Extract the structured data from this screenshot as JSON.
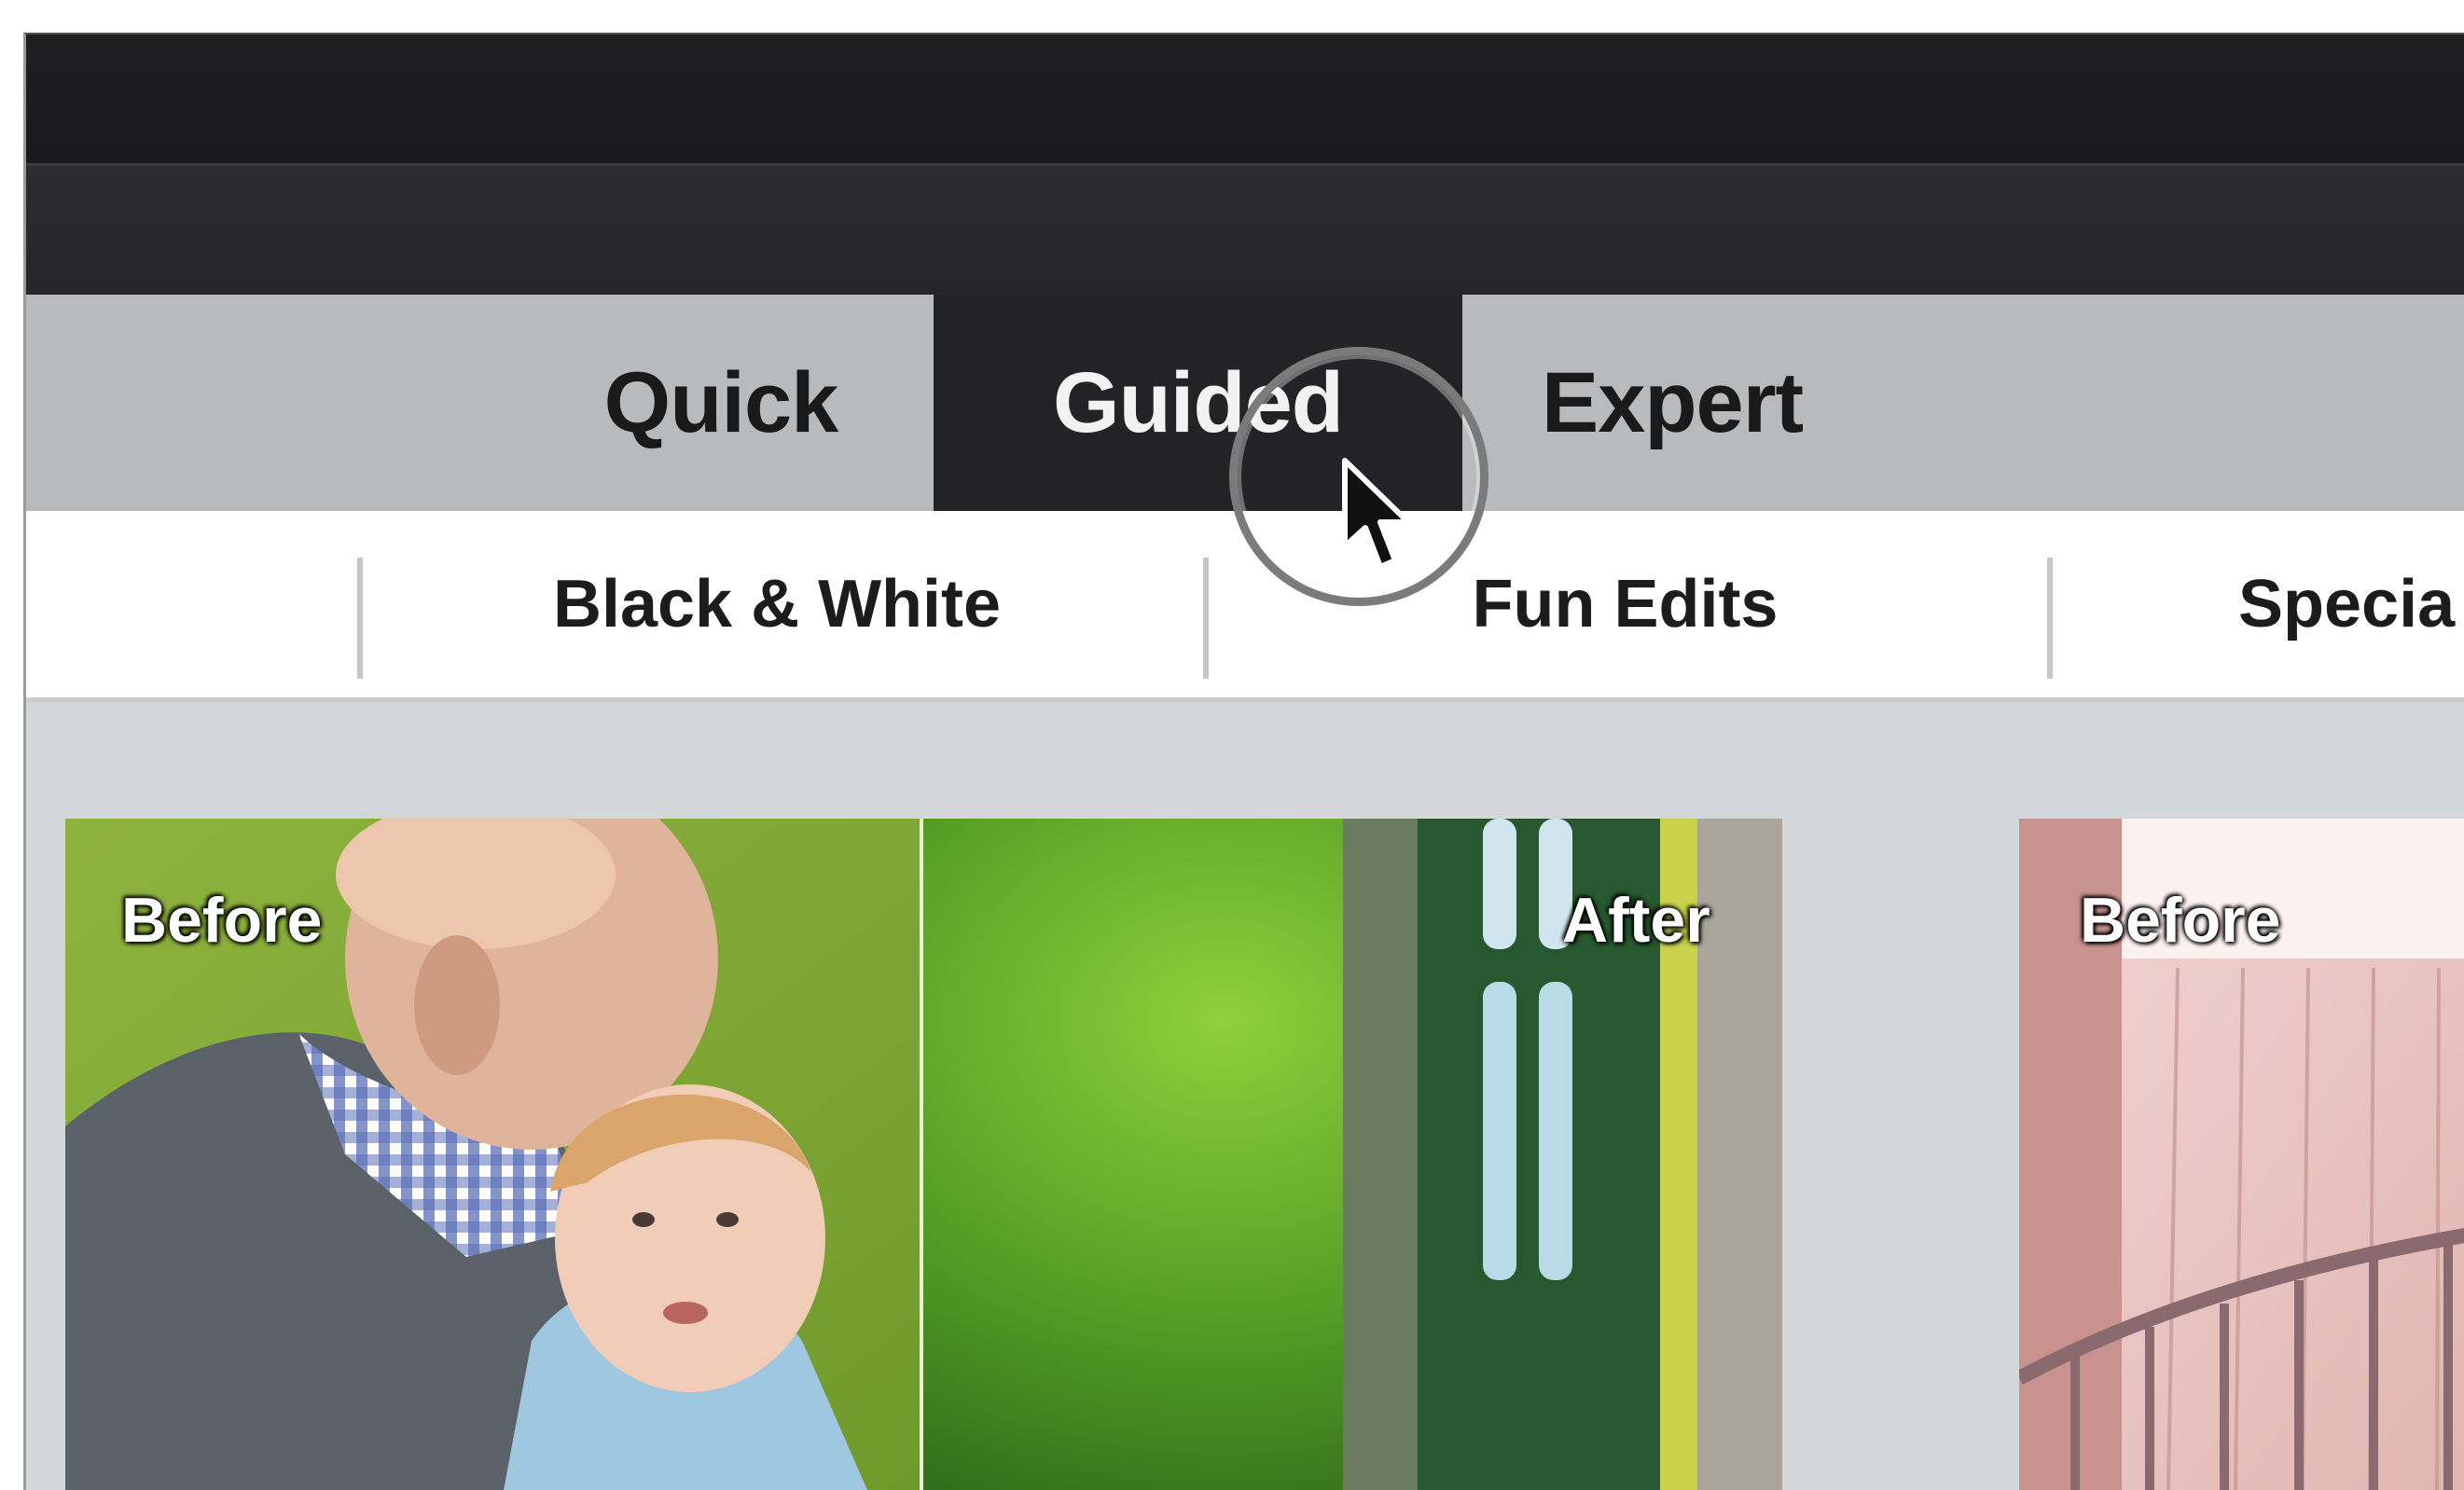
{
  "mode_tabs": {
    "quick": "Quick",
    "guided": "Guided",
    "expert": "Expert",
    "selected": "Guided"
  },
  "category_tabs": {
    "black_white": "Black & White",
    "fun_edits": "Fun Edits",
    "special": "Specia"
  },
  "thumbnails": [
    {
      "before_label": "Before",
      "after_label": "After"
    },
    {
      "before_label": "Before"
    }
  ],
  "colors": {
    "title_bar": "#1f1e20",
    "menu_bar": "#2c2c2e",
    "mode_bar": "#b8babc",
    "selected_mode_tab": "#232325",
    "content_bg": "#d4d7da"
  },
  "icons": {
    "cursor": "mouse-pointer-icon",
    "click_indicator": "click-ring-icon"
  }
}
